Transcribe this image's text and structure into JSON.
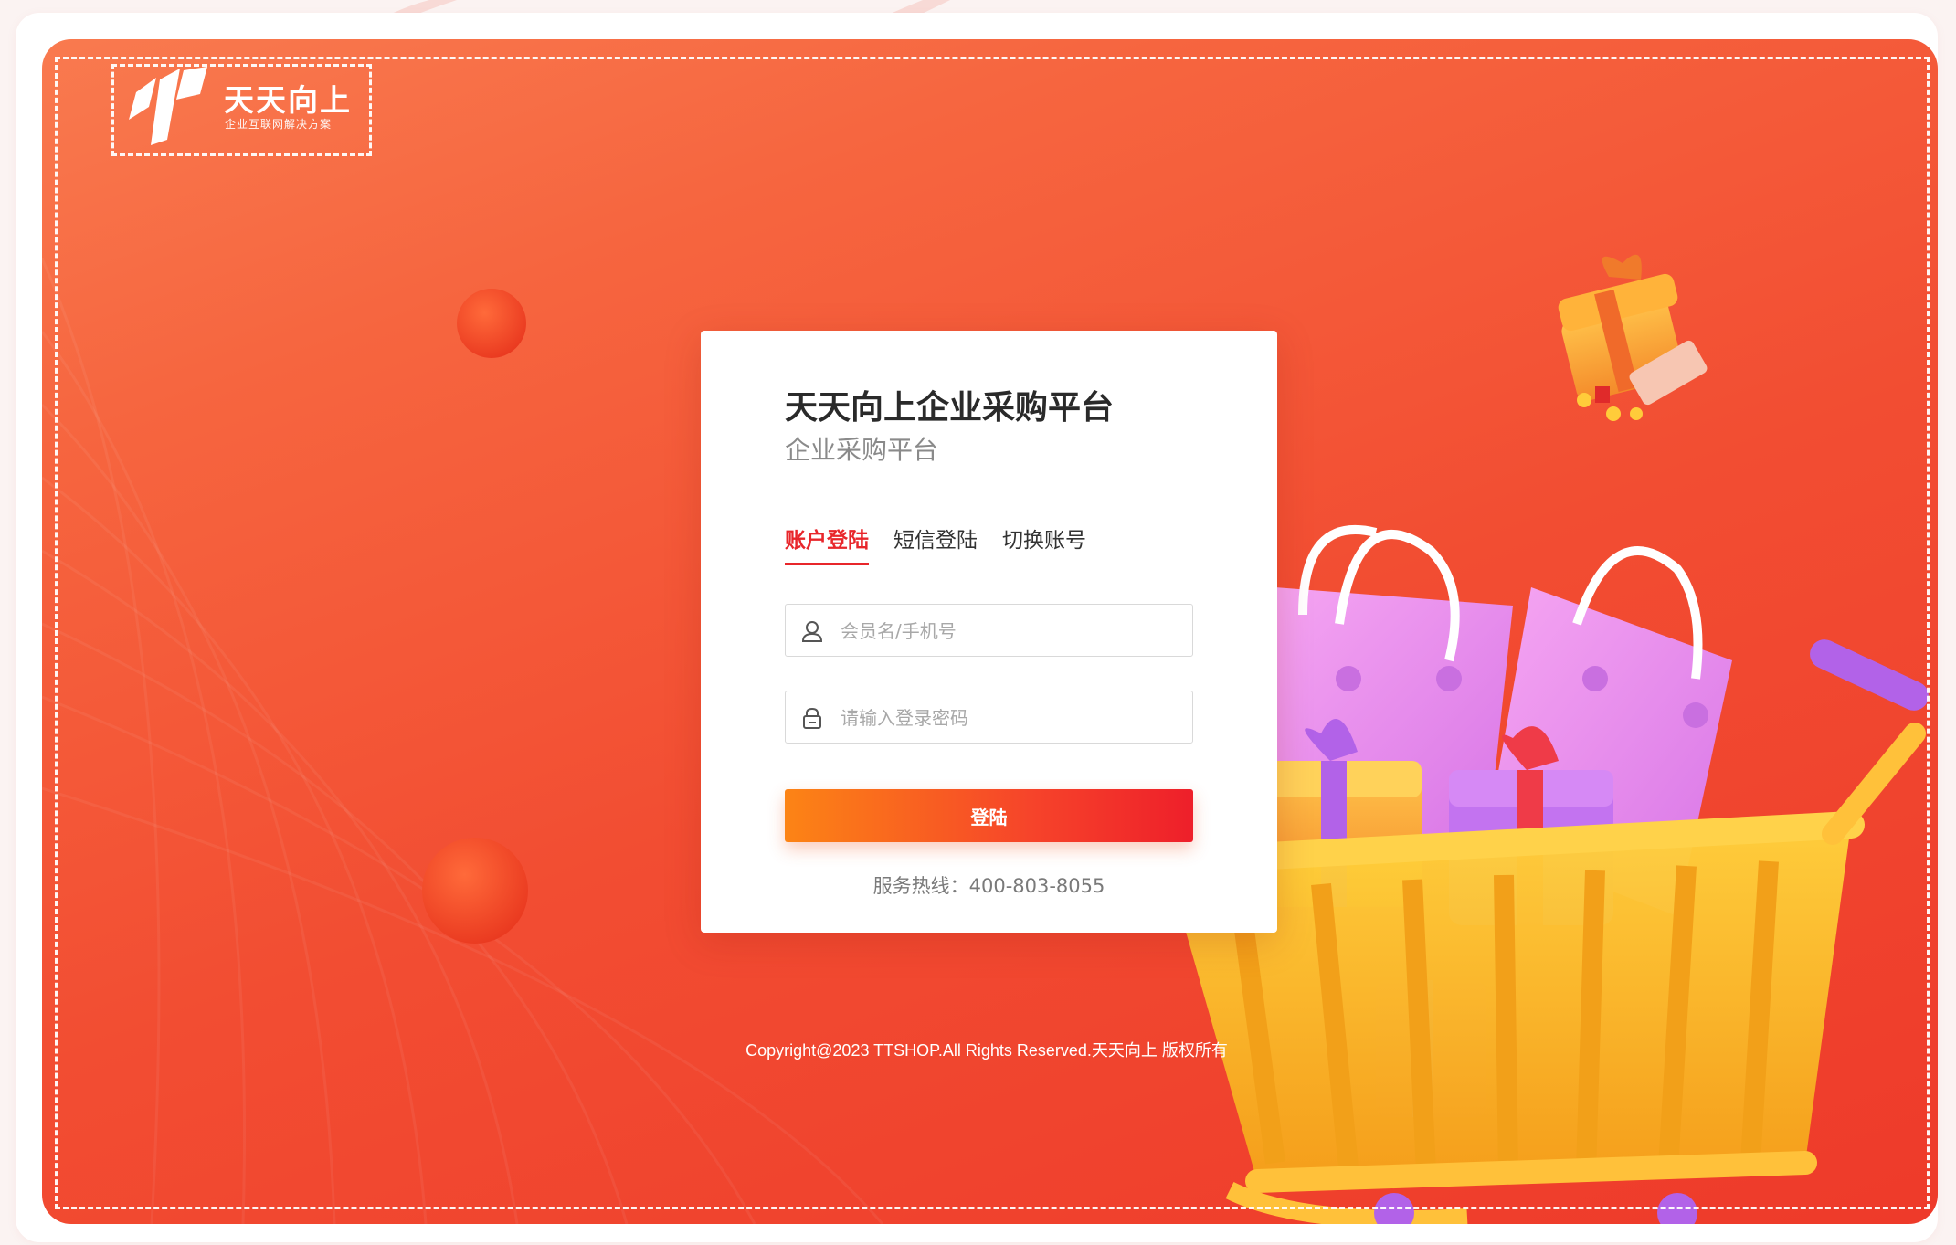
{
  "brand": {
    "name": "天天向上",
    "slogan": "企业互联网解决方案",
    "logo_icon": "brand-logo-mark"
  },
  "login": {
    "title": "天天向上企业采购平台",
    "subtitle": "企业采购平台",
    "tabs": [
      {
        "label": "账户登陆",
        "active": true
      },
      {
        "label": "短信登陆",
        "active": false
      },
      {
        "label": "切换账号",
        "active": false
      }
    ],
    "username": {
      "value": "",
      "placeholder": "会员名/手机号",
      "icon": "user-icon"
    },
    "password": {
      "value": "",
      "placeholder": "请输入登录密码",
      "icon": "lock-icon"
    },
    "submit_label": "登陆",
    "hotline": "服务热线：400-803-8055"
  },
  "footer": {
    "copyright": "Copyright@2023 TTSHOP.All Rights Reserved.天天向上 版权所有"
  },
  "colors": {
    "accent": "#e8262b",
    "button_start": "#fc8415",
    "button_end": "#ee1f2a",
    "hero_top": "#f97a4f",
    "hero_bottom": "#ee3a2a"
  }
}
